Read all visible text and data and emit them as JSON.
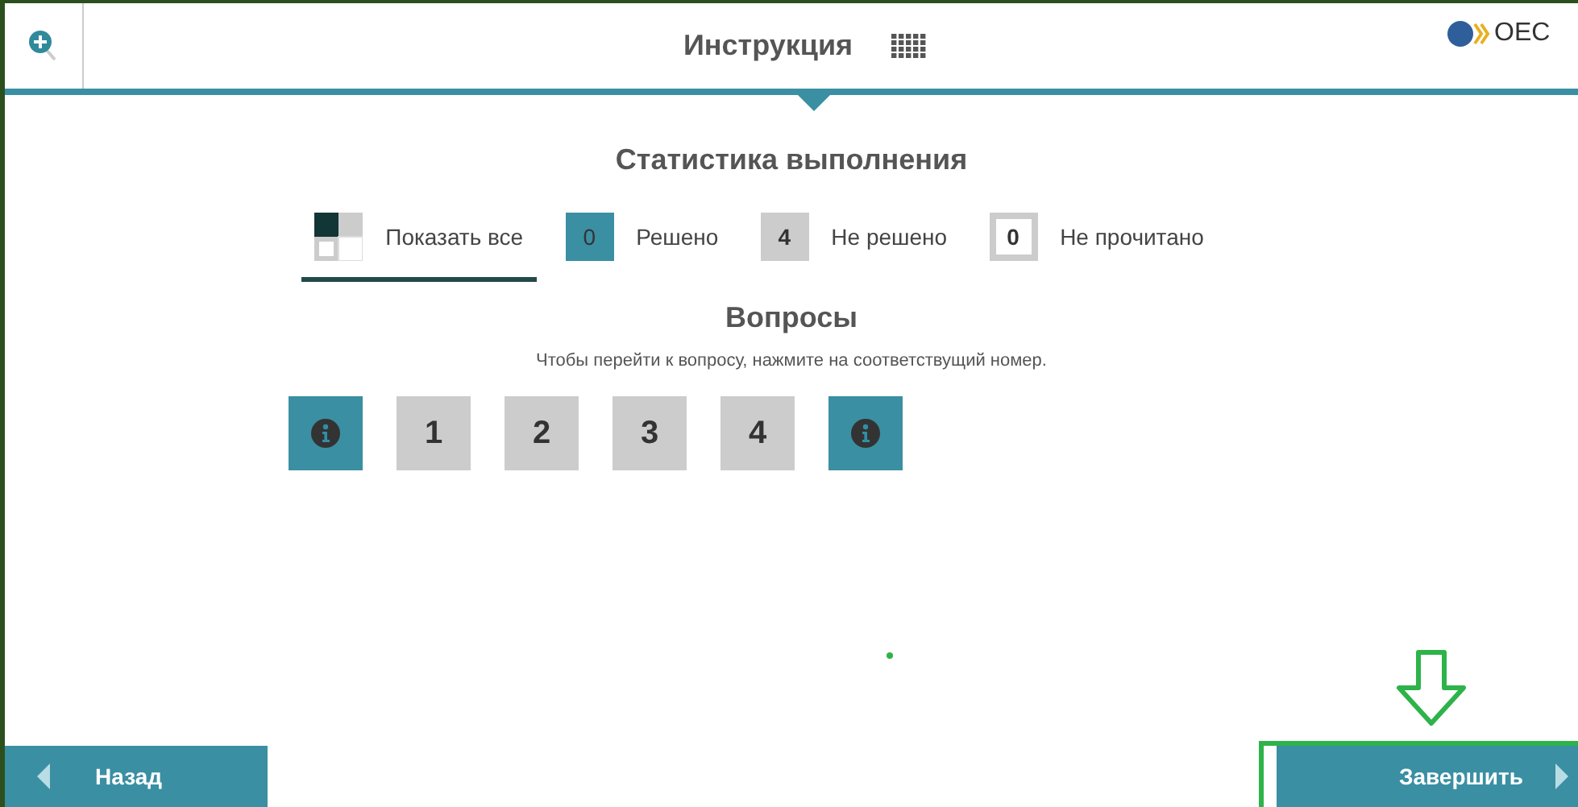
{
  "header": {
    "title": "Инструкция",
    "logo_text": "OEC"
  },
  "stats": {
    "title": "Статистика выполнения",
    "filters": [
      {
        "kind": "all",
        "label": "Показать все",
        "selected": true
      },
      {
        "kind": "solved",
        "count": "0",
        "label": "Решено",
        "selected": false
      },
      {
        "kind": "unsolved",
        "count": "4",
        "label": "Не решено",
        "selected": false
      },
      {
        "kind": "unread",
        "count": "0",
        "label": "Не прочитано",
        "selected": false
      }
    ]
  },
  "questions": {
    "title": "Вопросы",
    "hint": "Чтобы перейти к вопросу, нажмите на соответствущий номер.",
    "items": [
      {
        "kind": "info"
      },
      {
        "kind": "number",
        "label": "1"
      },
      {
        "kind": "number",
        "label": "2"
      },
      {
        "kind": "number",
        "label": "3"
      },
      {
        "kind": "number",
        "label": "4"
      },
      {
        "kind": "info"
      }
    ]
  },
  "footer": {
    "back": "Назад",
    "finish": "Завершить",
    "finish_highlighted": true
  }
}
